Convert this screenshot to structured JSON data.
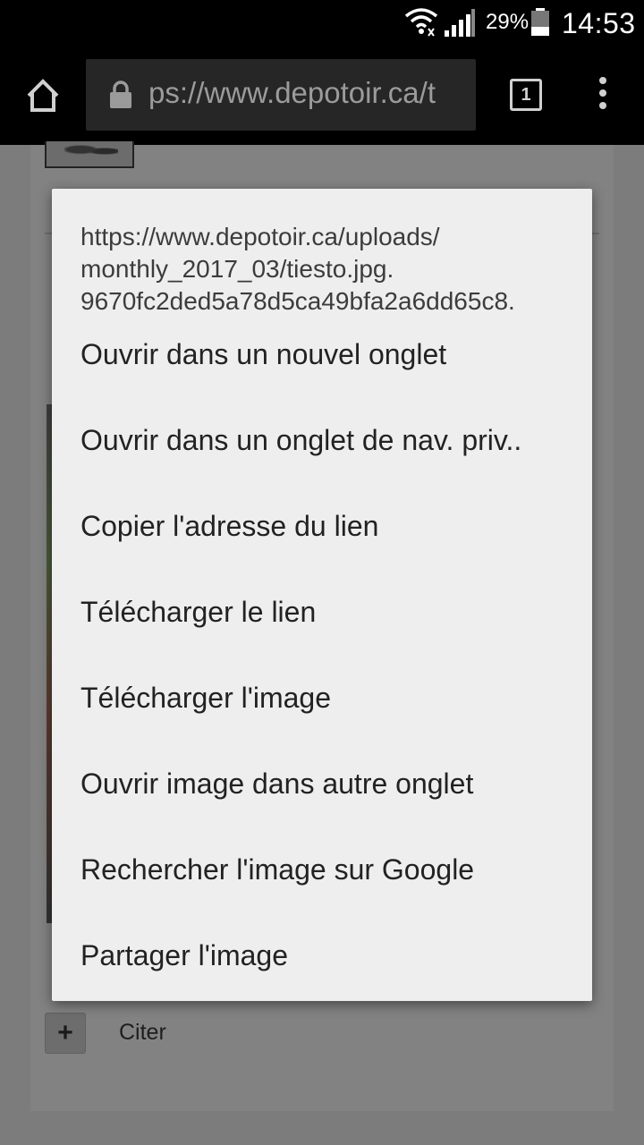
{
  "status_bar": {
    "battery_percent": "29%",
    "time": "14:53",
    "icons": [
      "wifi-icon",
      "signal-icon",
      "battery-icon"
    ]
  },
  "toolbar": {
    "url": "ps://www.depotoir.ca/t",
    "tab_count": "1",
    "icons": [
      "home-icon",
      "lock-icon",
      "tabs-icon",
      "overflow-menu-icon"
    ]
  },
  "page": {
    "quote_label": "Citer",
    "quote_icon": "+"
  },
  "context_menu": {
    "url_lines": [
      "https://www.depotoir.ca/uploads/",
      "monthly_2017_03/tiesto.jpg.",
      "9670fc2ded5a78d5ca49bfa2a6dd65c8."
    ],
    "items": [
      "Ouvrir dans un nouvel onglet",
      "Ouvrir dans un onglet de nav. priv..",
      "Copier l'adresse du lien",
      "Télécharger le lien",
      "Télécharger l'image",
      "Ouvrir image dans autre onglet",
      "Rechercher l'image sur Google",
      "Partager l'image"
    ]
  },
  "colors": {
    "menu_background": "#eeeeee",
    "toolbar_background": "#000000",
    "url_box_background": "#262626",
    "scrim": "#7a7a7a"
  }
}
